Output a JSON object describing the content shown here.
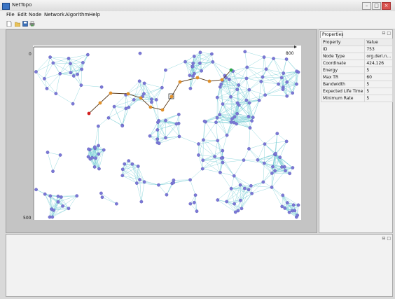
{
  "window": {
    "title": "NetTopo",
    "controls": [
      "–",
      "□",
      "×"
    ]
  },
  "menu": [
    "File",
    "Edit",
    "Node",
    "Network",
    "Algorithm",
    "Help"
  ],
  "toolbar": [
    "new",
    "open",
    "save",
    "print"
  ],
  "canvas": {
    "x_min_label": "0",
    "x_max_label": "800",
    "y_max_label": "500"
  },
  "properties": {
    "tab": "Properties",
    "controls": "⊟ □",
    "headers": [
      "Property",
      "Value"
    ],
    "rows": [
      [
        "ID",
        "753"
      ],
      [
        "Node Type",
        "org.deri.n..."
      ],
      [
        "Coordinate",
        "424,126"
      ],
      [
        "Energy",
        "5"
      ],
      [
        "Max TR",
        "60"
      ],
      [
        "Bandwidth",
        "5"
      ],
      [
        "Expected Life Time",
        "5"
      ],
      [
        "Minimum Rate",
        "5"
      ]
    ]
  },
  "bottom_panel": {
    "controls": "⊟ □"
  },
  "colors": {
    "node": "#7b78d6",
    "edge": "#7ccfd6",
    "path": "#5a3a1a",
    "path_node": "#e0902a",
    "source": "#d42020",
    "sink": "#2aa84a"
  }
}
